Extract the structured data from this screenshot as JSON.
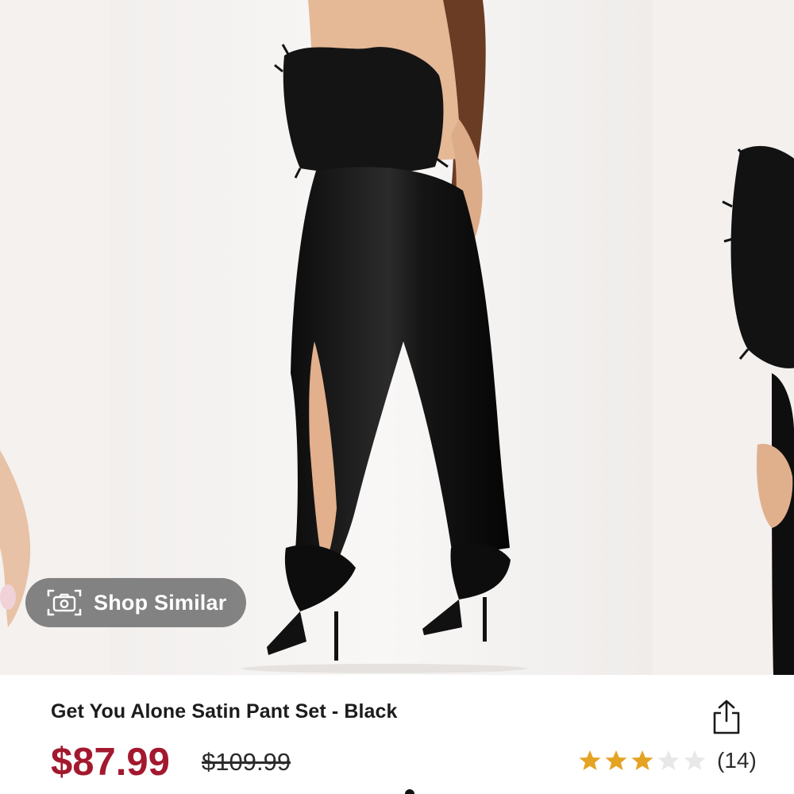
{
  "carousel": {
    "shop_similar_label": "Shop Similar",
    "icons": {
      "shop_similar": "camera-icon"
    }
  },
  "product": {
    "title": "Get You Alone Satin Pant Set - Black",
    "price": "$87.99",
    "original_price": "$109.99",
    "rating": {
      "stars": 3,
      "max": 5,
      "review_count": "(14)"
    }
  },
  "icons": {
    "share": "share-icon",
    "star": "star-icon"
  },
  "colors": {
    "sale_price": "#a3182e",
    "star_filled": "#e5a323",
    "star_empty": "#e8e8e8",
    "badge_bg": "#6e6e6e"
  }
}
